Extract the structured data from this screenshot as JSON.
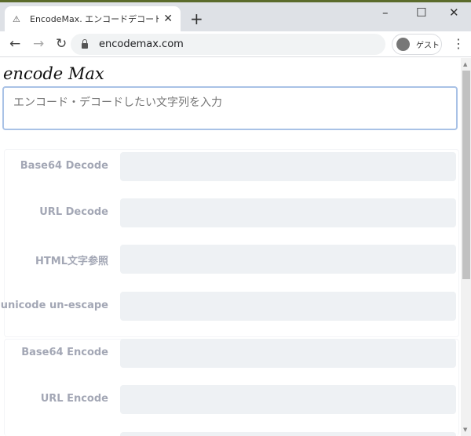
{
  "browser": {
    "tab_title": "EncodeMax. エンコードデコードをリアルタイム",
    "url": "encodemax.com",
    "profile": "ゲスト",
    "new_tab": "+",
    "close": "✕",
    "minimize": "–",
    "maximize": "☐",
    "win_close": "✕"
  },
  "page": {
    "title": "encode Max",
    "input_placeholder": "エンコード・デコードしたい文字列を入力",
    "rows": [
      {
        "label": "Base64 Decode"
      },
      {
        "label": "URL Decode"
      },
      {
        "label": "HTML文字参照"
      },
      {
        "label": "unicode un-escape"
      },
      {
        "label": "Base64 Encode"
      },
      {
        "label": "URL Encode"
      },
      {
        "label": ""
      }
    ]
  }
}
